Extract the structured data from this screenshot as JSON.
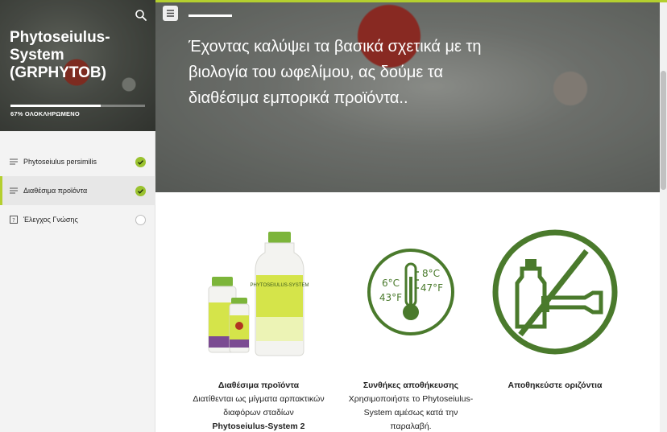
{
  "sidebar": {
    "course_title": "Phytoseiulus-System (GRPHYTOB)",
    "progress_label": "67% ΟΛΟΚΛΗΡΩΜΕΝΟ",
    "progress": 0.67,
    "items": [
      {
        "label": "Phytoseiulus persimilis",
        "icon": "lines-icon",
        "status": "complete"
      },
      {
        "label": "Διαθέσιμα προϊόντα",
        "icon": "lines-icon",
        "status": "complete",
        "active": true
      },
      {
        "label": "Έλεγχος Γνώσης",
        "icon": "quiz-icon",
        "status": "incomplete"
      }
    ]
  },
  "hero": {
    "text": "Έχοντας καλύψει τα βασικά σχετικά με τη βιολογία του ωφελίμου, ας δούμε τα διαθέσιμα εμπορικά προϊόντα.."
  },
  "columns": [
    {
      "title": "Διαθέσιμα προϊόντα",
      "body": "Διατίθενται ως μίγματα αρπακτικών διαφόρων σταδίων",
      "body_bold": "Phytoseiulus-System 2",
      "image": "product-bottles",
      "bottle_label": "PHYTOSEIULUS-SYSTEM"
    },
    {
      "title": "Συνθήκες αποθήκευσης",
      "body": "Χρησιμοποιήστε το Phytoseiulus-System αμέσως κατά την παραλαβή.",
      "image": "thermometer-icon",
      "temps": {
        "c_low": "6°C",
        "f_low": "43°F",
        "c_high": "8°C",
        "f_high": "47°F"
      }
    },
    {
      "title": "Αποθηκεύστε οριζόντια",
      "body": "",
      "image": "no-upright-bottle-icon"
    }
  ],
  "colors": {
    "accent": "#b4cf2f",
    "check": "#9ac22f",
    "icon_green": "#4a7a2c"
  }
}
